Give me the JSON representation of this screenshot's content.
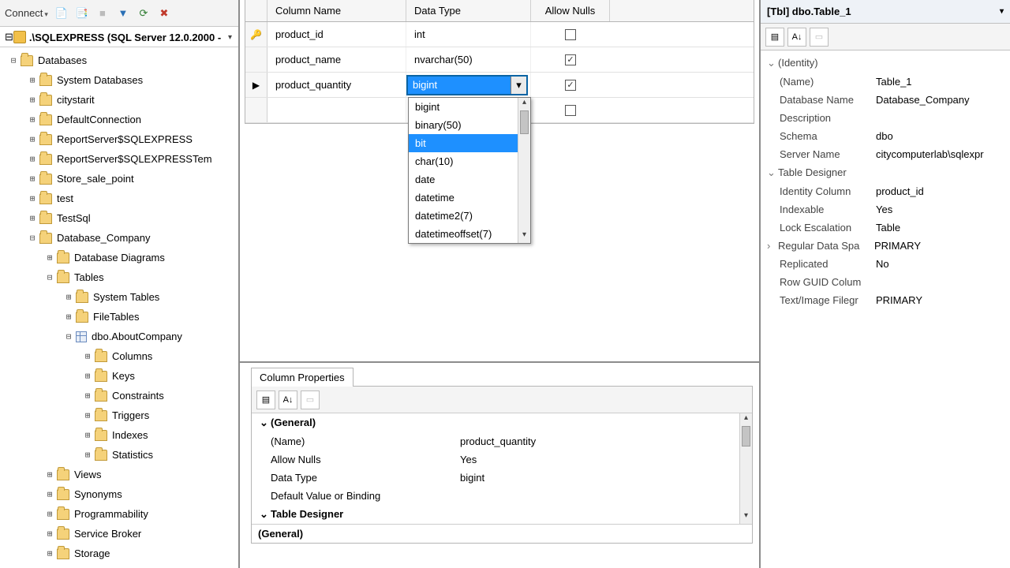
{
  "toolbar": {
    "connect": "Connect"
  },
  "tree_header": ".\\SQLEXPRESS (SQL Server 12.0.2000 -",
  "tree": {
    "databases": "Databases",
    "items": [
      "System Databases",
      "citystarit",
      "DefaultConnection",
      "ReportServer$SQLEXPRESS",
      "ReportServer$SQLEXPRESSTem",
      "Store_sale_point",
      "test",
      "TestSql",
      "Database_Company"
    ],
    "db_children": [
      "Database Diagrams",
      "Tables"
    ],
    "tables_children": [
      "System Tables",
      "FileTables",
      "dbo.AboutCompany"
    ],
    "about_children": [
      "Columns",
      "Keys",
      "Constraints",
      "Triggers",
      "Indexes",
      "Statistics"
    ],
    "tail": [
      "Views",
      "Synonyms",
      "Programmability",
      "Service Broker",
      "Storage"
    ]
  },
  "grid": {
    "headers": {
      "name": "Column Name",
      "type": "Data Type",
      "null": "Allow Nulls"
    },
    "rows": [
      {
        "name": "product_id",
        "type": "int",
        "null": false,
        "pk": true
      },
      {
        "name": "product_name",
        "type": "nvarchar(50)",
        "null": true
      },
      {
        "name": "product_quantity",
        "type": "bigint",
        "null": true,
        "editing": true
      }
    ],
    "dropdown": [
      "bigint",
      "binary(50)",
      "bit",
      "char(10)",
      "date",
      "datetime",
      "datetime2(7)",
      "datetimeoffset(7)"
    ],
    "dropdown_hilite": "bit"
  },
  "col_props": {
    "tab": "Column Properties",
    "general": "(General)",
    "rows": [
      {
        "k": "(Name)",
        "v": "product_quantity"
      },
      {
        "k": "Allow Nulls",
        "v": "Yes"
      },
      {
        "k": "Data Type",
        "v": "bigint"
      },
      {
        "k": "Default Value or Binding",
        "v": ""
      }
    ],
    "td": "Table Designer",
    "foot": "(General)"
  },
  "right": {
    "title": "[Tbl] dbo.Table_1",
    "identity": "(Identity)",
    "rows1": [
      {
        "k": "(Name)",
        "v": "Table_1"
      },
      {
        "k": "Database Name",
        "v": "Database_Company"
      },
      {
        "k": "Description",
        "v": ""
      },
      {
        "k": "Schema",
        "v": "dbo"
      },
      {
        "k": "Server Name",
        "v": "citycomputerlab\\sqlexpr"
      }
    ],
    "td": "Table Designer",
    "rows2": [
      {
        "k": "Identity Column",
        "v": "product_id"
      },
      {
        "k": "Indexable",
        "v": "Yes"
      },
      {
        "k": "Lock Escalation",
        "v": "Table"
      },
      {
        "k": "Regular Data Spa",
        "v": "PRIMARY",
        "expand": true
      },
      {
        "k": "Replicated",
        "v": "No"
      },
      {
        "k": "Row GUID Colum",
        "v": ""
      },
      {
        "k": "Text/Image Filegr",
        "v": "PRIMARY"
      }
    ]
  }
}
